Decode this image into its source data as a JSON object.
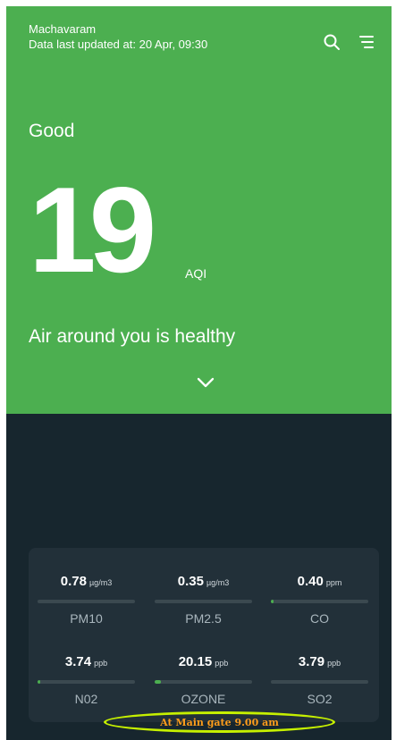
{
  "header": {
    "location": "Machavaram",
    "updated": "Data last updated at: 20 Apr, 09:30",
    "search_icon": "search-icon",
    "filter_icon": "filter-icon"
  },
  "aqi": {
    "status": "Good",
    "value": "19",
    "unit": "AQI",
    "message": "Air around you is healthy",
    "expand_icon": "chevron-down-icon"
  },
  "pollutants": [
    {
      "value": "0.78",
      "unit": "µg/m3",
      "label": "PM10",
      "level": 0.0
    },
    {
      "value": "0.35",
      "unit": "µg/m3",
      "label": "PM2.5",
      "level": 0.0
    },
    {
      "value": "0.40",
      "unit": "ppm",
      "label": "CO",
      "level": 0.02
    },
    {
      "value": "3.74",
      "unit": "ppb",
      "label": "N02",
      "level": 0.02
    },
    {
      "value": "20.15",
      "unit": "ppb",
      "label": "OZONE",
      "level": 0.06
    },
    {
      "value": "3.79",
      "unit": "ppb",
      "label": "SO2",
      "level": 0.0
    }
  ],
  "annotation": {
    "text": "At Main gate 9.00 am"
  },
  "colors": {
    "accent": "#4caf50",
    "background": "#17262e",
    "card": "#223039",
    "annotation_outline": "#c6f000",
    "annotation_text": "#ff9d1b"
  }
}
